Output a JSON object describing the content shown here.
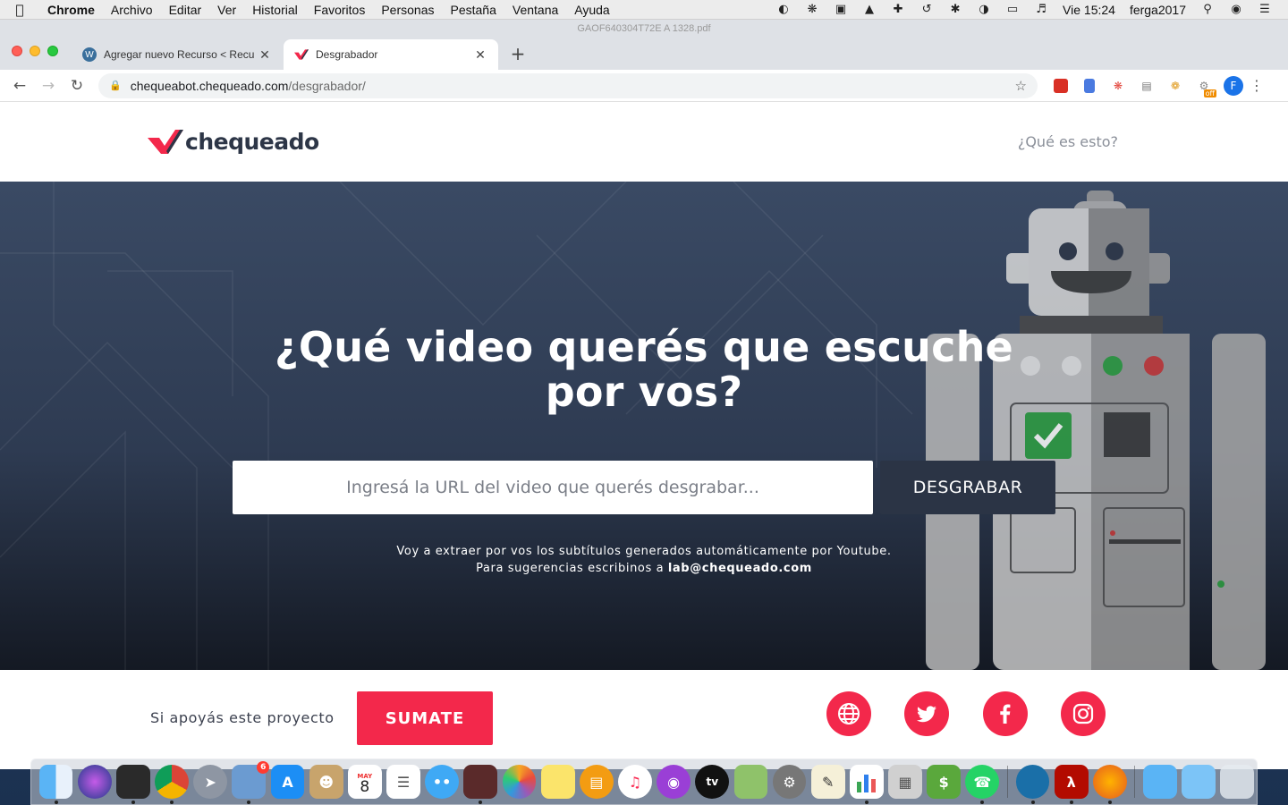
{
  "menubar": {
    "app_name": "Chrome",
    "menus": [
      "Archivo",
      "Editar",
      "Ver",
      "Historial",
      "Favoritos",
      "Personas",
      "Pestaña",
      "Ventana",
      "Ayuda"
    ],
    "clock": "Vie 15:24",
    "user": "ferga2017"
  },
  "browser": {
    "background_window_file": "GAOF640304T72E A 1328.pdf",
    "tabs": [
      {
        "title": "Agregar nuevo Recurso < Recu",
        "active": false
      },
      {
        "title": "Desgrabador",
        "active": true
      }
    ],
    "url_host": "chequeabot.chequeado.com",
    "url_path": "/desgrabador/",
    "profile_initial": "F",
    "extension_badge": "off"
  },
  "site": {
    "logo_text": "chequeado",
    "nav_link": "¿Qué es esto?",
    "hero_title_line1": "¿Qué video querés que escuche",
    "hero_title_line2": "por vos?",
    "url_placeholder": "Ingresá la URL del video que querés desgrabar...",
    "submit_label": "DESGRABAR",
    "note_line1": "Voy a extraer por vos los subtítulos generados automáticamente por Youtube.",
    "note_line2_prefix": "Para sugerencias escribinos a",
    "note_email": "lab@chequeado.com",
    "support_text": "Si apoyás este proyecto",
    "support_button": "SUMATE",
    "social": [
      "globe-icon",
      "twitter-icon",
      "facebook-icon",
      "instagram-icon"
    ]
  },
  "colors": {
    "brand_red": "#f3284b",
    "dark_button": "#2b3445",
    "logo_text": "#2d3647"
  },
  "dock": {
    "calendar_month": "MAY",
    "calendar_day": "8",
    "mail_badge": "6",
    "appletv_label": "tv"
  }
}
